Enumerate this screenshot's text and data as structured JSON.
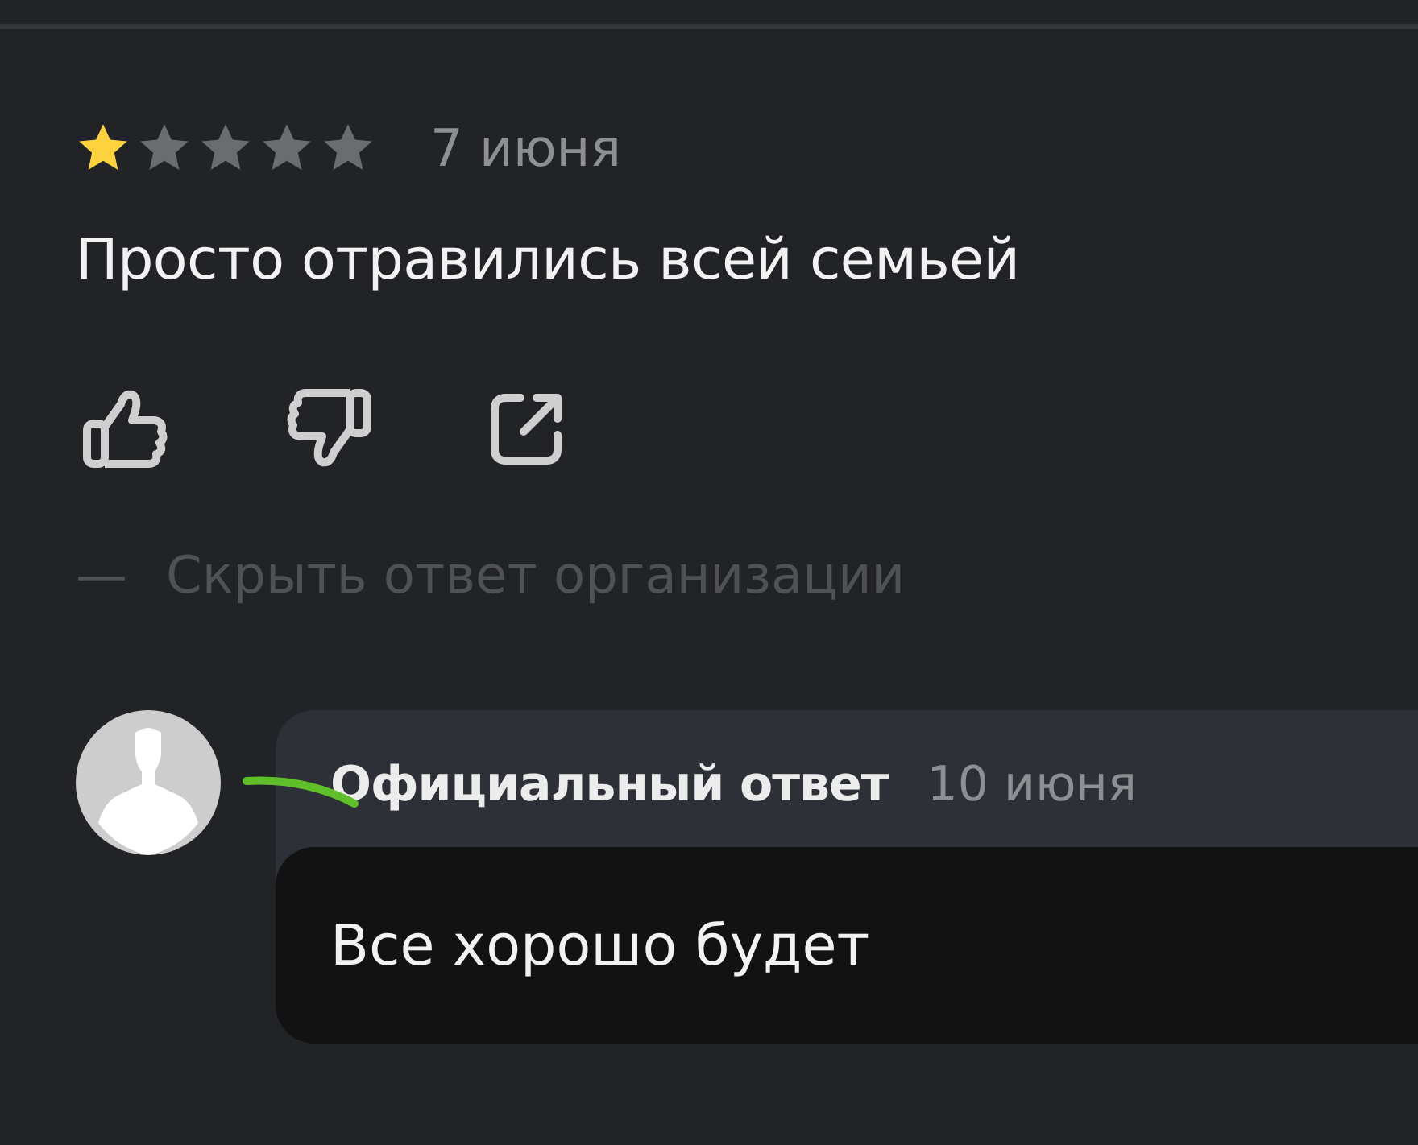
{
  "review": {
    "stars": 1,
    "date": "7 июня",
    "text": "Просто отравились всей семьей"
  },
  "hide_reply_link": {
    "dash": "—",
    "label": "Скрыть ответ организации"
  },
  "reply": {
    "title": "Официальный ответ",
    "date": "10 июня",
    "text": "Все хорошо будет"
  }
}
